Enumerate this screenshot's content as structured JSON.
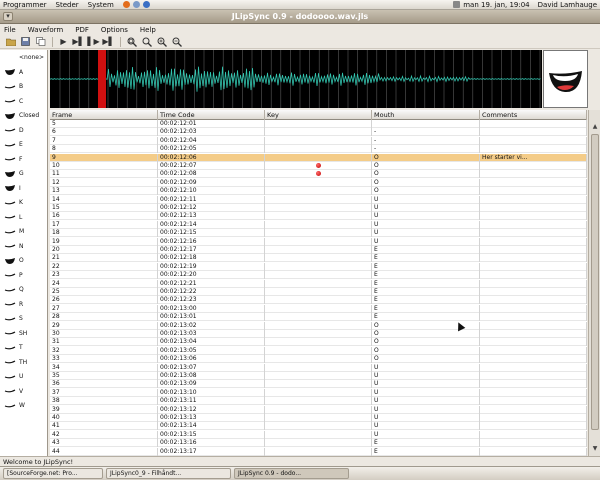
{
  "topbar": {
    "menus": [
      "Programmer",
      "Steder",
      "System"
    ],
    "clock": "man 19. jan, 19:04",
    "user": "David Lamhauge"
  },
  "window": {
    "title": "JLipSync 0.9  -  dodoooo.wav.jls"
  },
  "menubar": [
    "File",
    "Waveform",
    "PDF",
    "Options",
    "Help"
  ],
  "toolbar": {
    "icons": [
      "open-icon",
      "save-icon",
      "copy-icon",
      "play-icon",
      "step-forward-icon",
      "pause-marker-icon",
      "step-end-icon",
      "zoom-fit-icon",
      "zoom-icon",
      "zoom-in-icon",
      "zoom-out-icon"
    ]
  },
  "sidebar": [
    {
      "label": "<none>"
    },
    {
      "label": "A"
    },
    {
      "label": "B"
    },
    {
      "label": "C"
    },
    {
      "label": "Closed"
    },
    {
      "label": "D"
    },
    {
      "label": "E"
    },
    {
      "label": "F"
    },
    {
      "label": "G"
    },
    {
      "label": "I"
    },
    {
      "label": "K"
    },
    {
      "label": "L"
    },
    {
      "label": "M"
    },
    {
      "label": "N"
    },
    {
      "label": "O"
    },
    {
      "label": "P"
    },
    {
      "label": "Q"
    },
    {
      "label": "R"
    },
    {
      "label": "S"
    },
    {
      "label": "SH"
    },
    {
      "label": "T"
    },
    {
      "label": "TH"
    },
    {
      "label": "U"
    },
    {
      "label": "V"
    },
    {
      "label": "W"
    }
  ],
  "table": {
    "columns": [
      "Frame",
      "Time Code",
      "Key",
      "Mouth",
      "Comments"
    ],
    "rows": [
      {
        "frame": "5",
        "time": "00:02:12:01",
        "key": false,
        "mouth": "",
        "comment": ""
      },
      {
        "frame": "6",
        "time": "00:02:12:03",
        "key": false,
        "mouth": "-",
        "comment": ""
      },
      {
        "frame": "7",
        "time": "00:02:12:04",
        "key": false,
        "mouth": "-",
        "comment": ""
      },
      {
        "frame": "8",
        "time": "00:02:12:05",
        "key": false,
        "mouth": "-",
        "comment": ""
      },
      {
        "frame": "9",
        "time": "00:02:12:06",
        "key": false,
        "mouth": "O",
        "comment": "Her starter vi...",
        "selected": true
      },
      {
        "frame": "10",
        "time": "00:02:12:07",
        "key": true,
        "mouth": "O",
        "comment": ""
      },
      {
        "frame": "11",
        "time": "00:02:12:08",
        "key": true,
        "mouth": "O",
        "comment": ""
      },
      {
        "frame": "12",
        "time": "00:02:12:09",
        "key": false,
        "mouth": "O",
        "comment": ""
      },
      {
        "frame": "13",
        "time": "00:02:12:10",
        "key": false,
        "mouth": "O",
        "comment": ""
      },
      {
        "frame": "14",
        "time": "00:02:12:11",
        "key": false,
        "mouth": "U",
        "comment": ""
      },
      {
        "frame": "15",
        "time": "00:02:12:12",
        "key": false,
        "mouth": "U",
        "comment": ""
      },
      {
        "frame": "16",
        "time": "00:02:12:13",
        "key": false,
        "mouth": "U",
        "comment": ""
      },
      {
        "frame": "17",
        "time": "00:02:12:14",
        "key": false,
        "mouth": "U",
        "comment": ""
      },
      {
        "frame": "18",
        "time": "00:02:12:15",
        "key": false,
        "mouth": "U",
        "comment": ""
      },
      {
        "frame": "19",
        "time": "00:02:12:16",
        "key": false,
        "mouth": "U",
        "comment": ""
      },
      {
        "frame": "20",
        "time": "00:02:12:17",
        "key": false,
        "mouth": "E",
        "comment": ""
      },
      {
        "frame": "21",
        "time": "00:02:12:18",
        "key": false,
        "mouth": "E",
        "comment": ""
      },
      {
        "frame": "22",
        "time": "00:02:12:19",
        "key": false,
        "mouth": "E",
        "comment": ""
      },
      {
        "frame": "23",
        "time": "00:02:12:20",
        "key": false,
        "mouth": "E",
        "comment": ""
      },
      {
        "frame": "24",
        "time": "00:02:12:21",
        "key": false,
        "mouth": "E",
        "comment": ""
      },
      {
        "frame": "25",
        "time": "00:02:12:22",
        "key": false,
        "mouth": "E",
        "comment": ""
      },
      {
        "frame": "26",
        "time": "00:02:12:23",
        "key": false,
        "mouth": "E",
        "comment": ""
      },
      {
        "frame": "27",
        "time": "00:02:13:00",
        "key": false,
        "mouth": "E",
        "comment": ""
      },
      {
        "frame": "28",
        "time": "00:02:13:01",
        "key": false,
        "mouth": "E",
        "comment": ""
      },
      {
        "frame": "29",
        "time": "00:02:13:02",
        "key": false,
        "mouth": "O",
        "comment": ""
      },
      {
        "frame": "30",
        "time": "00:02:13:03",
        "key": false,
        "mouth": "O",
        "comment": ""
      },
      {
        "frame": "31",
        "time": "00:02:13:04",
        "key": false,
        "mouth": "O",
        "comment": ""
      },
      {
        "frame": "32",
        "time": "00:02:13:05",
        "key": false,
        "mouth": "O",
        "comment": ""
      },
      {
        "frame": "33",
        "time": "00:02:13:06",
        "key": false,
        "mouth": "O",
        "comment": ""
      },
      {
        "frame": "34",
        "time": "00:02:13:07",
        "key": false,
        "mouth": "U",
        "comment": ""
      },
      {
        "frame": "35",
        "time": "00:02:13:08",
        "key": false,
        "mouth": "U",
        "comment": ""
      },
      {
        "frame": "36",
        "time": "00:02:13:09",
        "key": false,
        "mouth": "U",
        "comment": ""
      },
      {
        "frame": "37",
        "time": "00:02:13:10",
        "key": false,
        "mouth": "U",
        "comment": ""
      },
      {
        "frame": "38",
        "time": "00:02:13:11",
        "key": false,
        "mouth": "U",
        "comment": ""
      },
      {
        "frame": "39",
        "time": "00:02:13:12",
        "key": false,
        "mouth": "U",
        "comment": ""
      },
      {
        "frame": "40",
        "time": "00:02:13:13",
        "key": false,
        "mouth": "U",
        "comment": ""
      },
      {
        "frame": "41",
        "time": "00:02:13:14",
        "key": false,
        "mouth": "U",
        "comment": ""
      },
      {
        "frame": "42",
        "time": "00:02:13:15",
        "key": false,
        "mouth": "U",
        "comment": ""
      },
      {
        "frame": "43",
        "time": "00:02:13:16",
        "key": false,
        "mouth": "E",
        "comment": ""
      },
      {
        "frame": "44",
        "time": "00:02:13:17",
        "key": false,
        "mouth": "E",
        "comment": ""
      }
    ]
  },
  "status": "Welcome to JLipSync!",
  "taskbar": [
    "[SourceForge.net: Pro...",
    "JLipSync0_9 - Filhåndt...",
    "JLipSync 0.9  -  dodo..."
  ],
  "colors": {
    "wave": "#33c6b0",
    "cursor_bar": "#d01010",
    "selected_row": "#f4cc88",
    "key_marker": "#d00000"
  }
}
